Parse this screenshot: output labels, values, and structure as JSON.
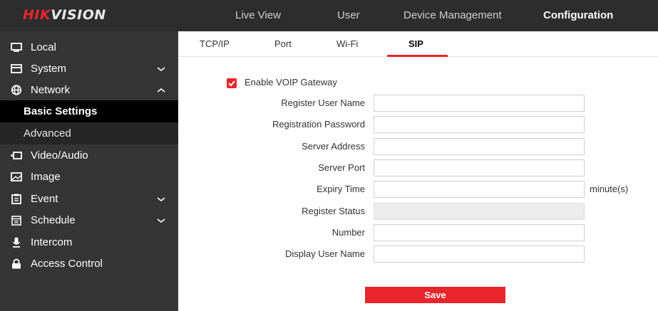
{
  "header": {
    "logo": {
      "part_red": "HIK",
      "part_white": "VISION"
    },
    "nav": [
      {
        "label": "Live View",
        "active": false
      },
      {
        "label": "User",
        "active": false
      },
      {
        "label": "Device Management",
        "active": false
      },
      {
        "label": "Configuration",
        "active": true
      }
    ]
  },
  "sidebar": {
    "items": [
      {
        "label": "Local",
        "icon": "monitor-icon"
      },
      {
        "label": "System",
        "icon": "system-icon",
        "chevron": "down"
      },
      {
        "label": "Network",
        "icon": "globe-icon",
        "chevron": "up"
      },
      {
        "label": "Video/Audio",
        "icon": "video-icon"
      },
      {
        "label": "Image",
        "icon": "image-icon"
      },
      {
        "label": "Event",
        "icon": "event-icon",
        "chevron": "down"
      },
      {
        "label": "Schedule",
        "icon": "schedule-icon",
        "chevron": "down"
      },
      {
        "label": "Intercom",
        "icon": "intercom-icon"
      },
      {
        "label": "Access Control",
        "icon": "lock-icon"
      }
    ],
    "network_sub": [
      {
        "label": "Basic Settings",
        "selected": true
      },
      {
        "label": "Advanced",
        "selected": false
      }
    ]
  },
  "tabs": [
    {
      "label": "TCP/IP",
      "active": false
    },
    {
      "label": "Port",
      "active": false
    },
    {
      "label": "Wi-Fi",
      "active": false
    },
    {
      "label": "SIP",
      "active": true
    }
  ],
  "form": {
    "enable_voip": {
      "label": "Enable VOIP Gateway",
      "checked": true
    },
    "fields": [
      {
        "label": "Register User Name",
        "value": ""
      },
      {
        "label": "Registration Password",
        "value": ""
      },
      {
        "label": "Server Address",
        "value": ""
      },
      {
        "label": "Server Port",
        "value": ""
      },
      {
        "label": "Expiry Time",
        "value": "",
        "unit": "minute(s)"
      },
      {
        "label": "Register Status",
        "value": "",
        "disabled": true
      },
      {
        "label": "Number",
        "value": ""
      },
      {
        "label": "Display User Name",
        "value": ""
      }
    ],
    "save_label": "Save"
  },
  "colors": {
    "accent": "#e8262b",
    "topbar": "#2d2d2d",
    "sidebar": "#353535",
    "selected": "#000000"
  }
}
